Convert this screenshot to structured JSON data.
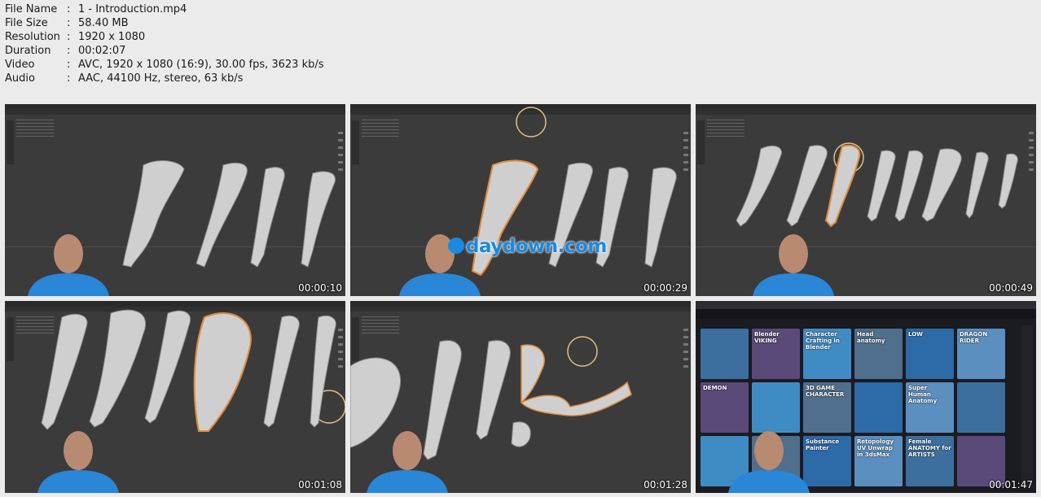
{
  "file_info": [
    {
      "key": "File Name",
      "value": "1 - Introduction.mp4"
    },
    {
      "key": "File Size",
      "value": "58.40 MB"
    },
    {
      "key": "Resolution",
      "value": "1920 x 1080"
    },
    {
      "key": "Duration",
      "value": "00:02:07"
    },
    {
      "key": "Video",
      "value": "AVC, 1920 x 1080 (16:9), 30.00 fps, 3623 kb/s"
    },
    {
      "key": "Audio",
      "value": "AAC, 44100 Hz, stereo, 63 kb/s"
    }
  ],
  "separator": ":",
  "thumbnails": [
    {
      "timestamp": "00:00:10"
    },
    {
      "timestamp": "00:00:29"
    },
    {
      "timestamp": "00:00:49"
    },
    {
      "timestamp": "00:01:08"
    },
    {
      "timestamp": "00:01:28"
    },
    {
      "timestamp": "00:01:47"
    }
  ],
  "watermark": "daydown.com",
  "tiles": [
    "",
    "Blender VIKING",
    "Character Crafting in Blender",
    "Head anatomy",
    "LOW",
    "DRAGON RIDER",
    "DEMON",
    "",
    "3D GAME CHARACTER",
    "",
    "Super Human Anatomy",
    "",
    "",
    "",
    "Substance Painter",
    "Retopology UV Unwrap in 3dsMax",
    "Female ANATOMY for ARTISTS",
    ""
  ],
  "colors": {
    "background": "#ebebeb",
    "viewport": "#3b3b3b",
    "watermark": "#1a8ae0",
    "shirt": "#2a86d6"
  }
}
